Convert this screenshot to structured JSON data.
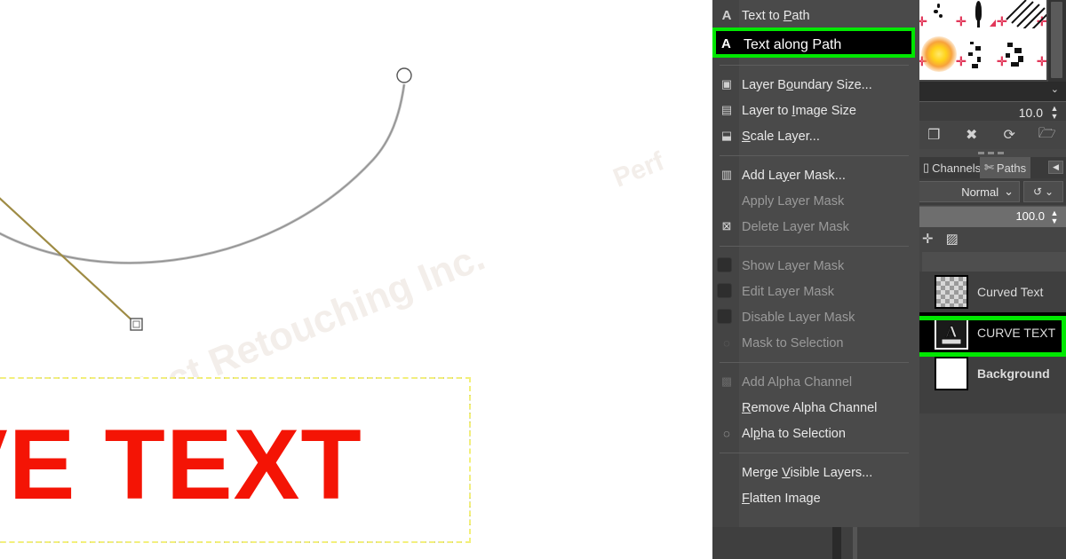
{
  "app": "GIMP",
  "canvas": {
    "red_text": "VE TEXT",
    "red_text_color": "#f41405",
    "selection_border_colors": [
      "#000000",
      "#f3f07a"
    ],
    "watermark_1": "Perfect Retouching Inc.",
    "watermark_2": "Perf",
    "path_stroke_color": "#9a9a9a",
    "handle_line_color": "#9e8b44"
  },
  "menu": {
    "highlight_color": "#00e800",
    "items": [
      {
        "label": "Text to Path",
        "icon": "text-path-icon",
        "icon_glyph": "A",
        "enabled": true,
        "type": "item",
        "mnemonic": "P"
      },
      {
        "label": "Text along Path",
        "icon": "text-along-path-icon",
        "icon_glyph": "A",
        "enabled": true,
        "type": "item",
        "highlighted": true,
        "mnemonic": "g"
      },
      {
        "type": "separator"
      },
      {
        "label": "Layer Boundary Size...",
        "icon": "layer-boundary-icon",
        "enabled": true,
        "type": "item",
        "mnemonic": "o"
      },
      {
        "label": "Layer to Image Size",
        "icon": "layer-to-image-icon",
        "enabled": true,
        "type": "item",
        "mnemonic": "I"
      },
      {
        "label": "Scale Layer...",
        "icon": "scale-layer-icon",
        "enabled": true,
        "type": "item",
        "mnemonic": "S"
      },
      {
        "type": "separator"
      },
      {
        "label": "Add Layer Mask...",
        "icon": "add-layer-mask-icon",
        "enabled": true,
        "type": "item",
        "mnemonic": "y"
      },
      {
        "label": "Apply Layer Mask",
        "icon": "",
        "enabled": false,
        "type": "item"
      },
      {
        "label": "Delete Layer Mask",
        "icon": "delete-layer-mask-icon",
        "enabled": false,
        "type": "item"
      },
      {
        "type": "separator"
      },
      {
        "label": "Show Layer Mask",
        "icon": "checkbox-icon",
        "enabled": false,
        "type": "check"
      },
      {
        "label": "Edit Layer Mask",
        "icon": "checkbox-icon",
        "enabled": false,
        "type": "check"
      },
      {
        "label": "Disable Layer Mask",
        "icon": "checkbox-icon",
        "enabled": false,
        "type": "check"
      },
      {
        "label": "Mask to Selection",
        "icon": "mask-to-selection-icon",
        "enabled": false,
        "type": "item"
      },
      {
        "type": "separator"
      },
      {
        "label": "Add Alpha Channel",
        "icon": "alpha-channel-icon",
        "enabled": false,
        "type": "item"
      },
      {
        "label": "Remove Alpha Channel",
        "icon": "",
        "enabled": true,
        "type": "item",
        "mnemonic": "R"
      },
      {
        "label": "Alpha to Selection",
        "icon": "alpha-to-selection-icon",
        "enabled": true,
        "type": "item",
        "mnemonic": "p"
      },
      {
        "type": "separator"
      },
      {
        "label": "Merge Visible Layers...",
        "icon": "",
        "enabled": true,
        "type": "item",
        "mnemonic": "V"
      },
      {
        "label": "Flatten Image",
        "icon": "",
        "enabled": true,
        "type": "item",
        "mnemonic": "F"
      }
    ]
  },
  "dock": {
    "brush_size": "10.0",
    "toolbar_icons": [
      {
        "name": "duplicate-brush-icon",
        "glyph": "❐"
      },
      {
        "name": "delete-brush-icon",
        "glyph": "✖"
      },
      {
        "name": "refresh-brushes-icon",
        "glyph": "⟳"
      },
      {
        "name": "open-brush-icon",
        "glyph": "🗁"
      }
    ],
    "tabs": [
      {
        "label": "Channels",
        "icon": "channels-icon",
        "active": false
      },
      {
        "label": "Paths",
        "icon": "paths-icon",
        "active": true
      }
    ],
    "tab_collapse_icon": "collapse-arrow-icon",
    "mode_label": "Normal",
    "mode_dropdown_icon": "chevron-down-icon",
    "undo_icon": "undo-history-icon",
    "undo_dropdown_icon": "chevron-down-icon",
    "opacity": "100.0",
    "small_icons": [
      {
        "name": "lock-position-icon",
        "glyph": "✛"
      },
      {
        "name": "lock-alpha-icon",
        "glyph": "▨"
      }
    ],
    "layers": [
      {
        "name": "Curved Text",
        "thumb": "checker",
        "selected": false,
        "bold": false
      },
      {
        "name": "CURVE TEXT",
        "thumb": "text",
        "thumb_glyph": "A",
        "selected": true,
        "bold": false
      },
      {
        "name": "Background",
        "thumb": "white",
        "selected": false,
        "bold": true
      }
    ],
    "selection_highlight_color": "#00e800"
  }
}
